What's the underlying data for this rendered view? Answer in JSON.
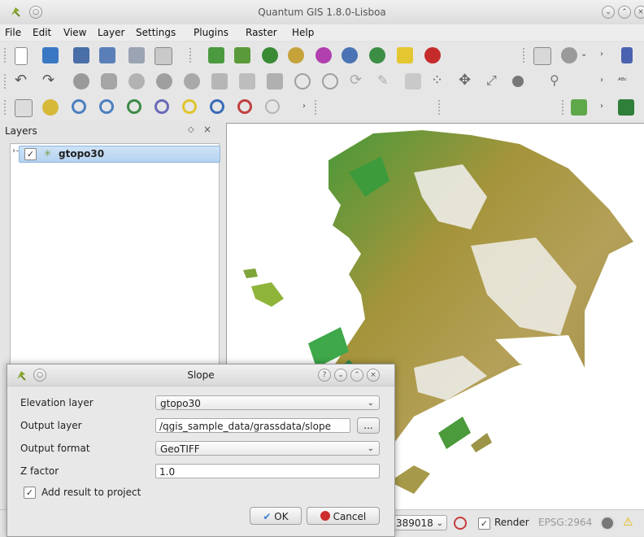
{
  "window": {
    "title": "Quantum GIS 1.8.0-Lisboa"
  },
  "menubar": {
    "items": [
      "File",
      "Edit",
      "View",
      "Layer",
      "Settings",
      "Plugins",
      "Raster",
      "Help"
    ]
  },
  "layers_panel": {
    "title": "Layers",
    "layers": [
      {
        "name": "gtopo30",
        "checked": true
      }
    ]
  },
  "statusbar": {
    "scale": "389018",
    "render_label": "Render",
    "crs": "EPSG:2964"
  },
  "dialog": {
    "title": "Slope",
    "fields": {
      "elevation_label": "Elevation layer",
      "elevation_value": "gtopo30",
      "output_label": "Output layer",
      "output_value": "/qgis_sample_data/grassdata/slope",
      "browse_label": "...",
      "format_label": "Output format",
      "format_value": "GeoTIFF",
      "zfactor_label": "Z factor",
      "zfactor_value": "1.0",
      "add_result_label": "Add result to project"
    },
    "ok_label": "OK",
    "cancel_label": "Cancel"
  },
  "colors": {
    "accent": "#3c7fd6",
    "map_green": "#3f9a3a",
    "map_olive": "#a5943b"
  }
}
